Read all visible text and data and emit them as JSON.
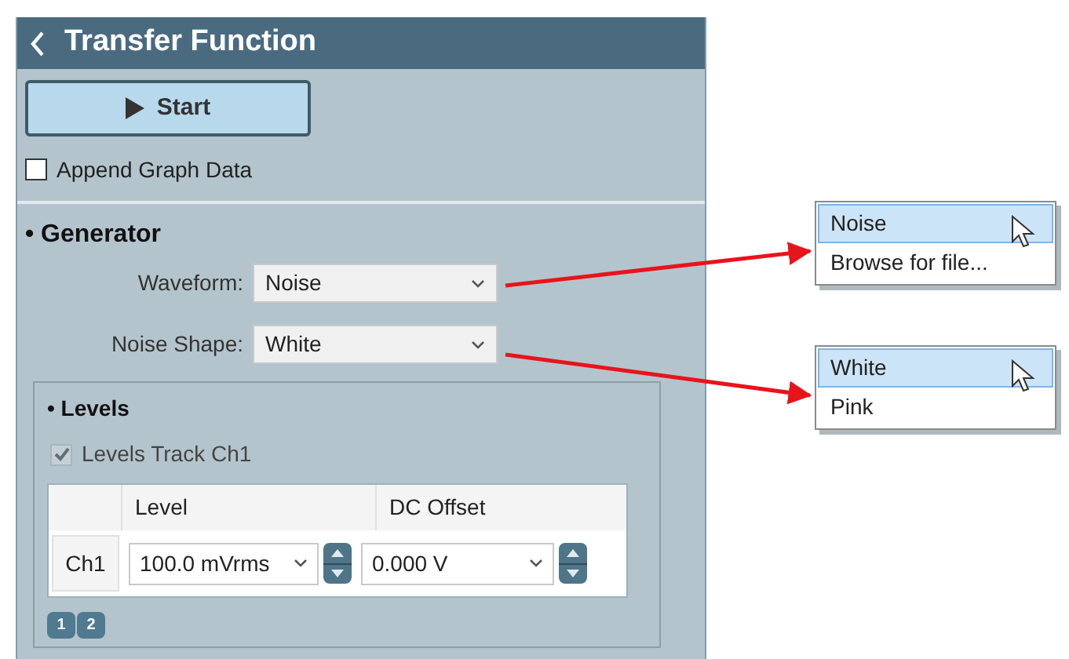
{
  "header": {
    "title": "Transfer Function"
  },
  "start_button": {
    "label": "Start"
  },
  "append_graph_data": {
    "label": "Append Graph Data",
    "checked": false
  },
  "generator": {
    "title": "• Generator",
    "fields": [
      {
        "label": "Waveform:",
        "value": "Noise"
      },
      {
        "label": "Noise Shape:",
        "value": "White"
      }
    ]
  },
  "levels": {
    "title": "• Levels",
    "track": {
      "label": "Levels Track Ch1",
      "checked": true,
      "disabled": true
    },
    "table": {
      "columns": [
        "Level",
        "DC Offset"
      ],
      "rows": [
        {
          "channel": "Ch1",
          "cells": [
            "100.0 mVrms",
            "0.000 V"
          ]
        }
      ]
    },
    "pages": [
      "1",
      "2"
    ]
  },
  "callouts": [
    {
      "items": [
        {
          "label": "Noise",
          "selected": true
        },
        {
          "label": "Browse for file...",
          "selected": false
        }
      ]
    },
    {
      "items": [
        {
          "label": "White",
          "selected": true
        },
        {
          "label": "Pink",
          "selected": false
        }
      ]
    }
  ]
}
